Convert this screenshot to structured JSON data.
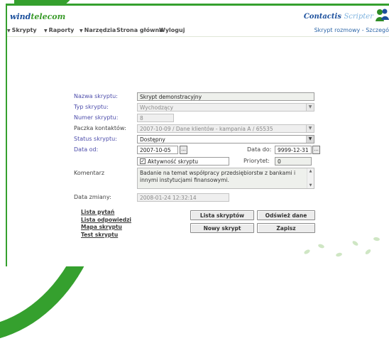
{
  "header": {
    "logo_left_a": "wind",
    "logo_left_b": "telecom",
    "logo_right_a": "Contactis",
    "logo_right_b": "Scripter"
  },
  "menu": {
    "items": [
      {
        "label": "Skrypty",
        "dropdown": true
      },
      {
        "label": "Raporty",
        "dropdown": true
      },
      {
        "label": "Narzędzia",
        "dropdown": true
      },
      {
        "label": "Strona główna",
        "dropdown": false
      },
      {
        "label": "Wyloguj",
        "dropdown": false
      }
    ],
    "breadcrumb": "Skrypt rozmowy - Szczegó"
  },
  "form": {
    "name_label": "Nazwa skryptu:",
    "name_value": "Skrypt demonstracyjny",
    "type_label": "Typ skryptu:",
    "type_value": "Wychodzący",
    "number_label": "Numer skryptu:",
    "number_value": "8",
    "package_label": "Paczka kontaktów:",
    "package_value": "2007-10-09 / Dane klientów - kampania A / 65535",
    "status_label": "Status skryptu:",
    "status_value": "Dostępny",
    "date_from_label": "Data od:",
    "date_from_value": "2007-10-05",
    "date_to_label": "Data do:",
    "date_to_value": "9999-12-31",
    "active_label": "Aktywność skryptu",
    "active_checked": true,
    "priority_label": "Priorytet:",
    "priority_value": "0",
    "comment_label": "Komentarz",
    "comment_value": "Badanie na temat współpracy przedsiębiorstw z bankami i innymi instytucjami finansowymi.",
    "changed_label": "Data zmiany:",
    "changed_value": "2008-01-24 12:32:14",
    "calendar_glyph": "..."
  },
  "links": [
    "Lista pytań",
    "Lista odpowiedzi",
    "Mapa skryptu",
    "Test skryptu"
  ],
  "buttons": {
    "script_list": "Lista skryptów",
    "refresh": "Odśwież dane",
    "new_script": "Nowy skrypt",
    "save": "Zapisz"
  },
  "colors": {
    "brand_green": "#35a02e",
    "brand_blue": "#1b4f9c",
    "label_purple": "#4d4dab"
  }
}
